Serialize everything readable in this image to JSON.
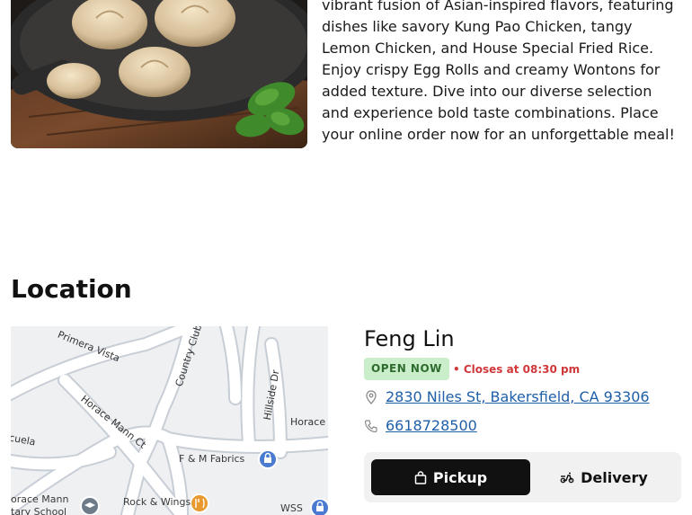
{
  "description": {
    "text": "vibrant fusion of Asian-inspired flavors, featuring dishes like savory Kung Pao Chicken, tangy Lemon Chicken, and House Special Fried Rice. Enjoy crispy Egg Rolls and creamy Wontons for added texture. Dive into our diverse selection and experience bold taste combinations. Place your online order now for an unforgettable meal!"
  },
  "location": {
    "title": "Location"
  },
  "map": {
    "streets": [
      "Primera Vista",
      "Country Club",
      "Hillside Dr",
      "Horace Mann Ct",
      "Horace",
      "cuela"
    ],
    "places": [
      "F & M Fabrics",
      "Rock & Wings",
      "WSS",
      "orace Mann",
      "tary School"
    ]
  },
  "restaurant": {
    "name": "Feng Lin",
    "status": "OPEN NOW",
    "closes": "• Closes at 08:30 pm",
    "address": "2830 Niles St, Bakersfield, CA 93306",
    "phone": "6618728500"
  },
  "order_mode": {
    "pickup_label": "Pickup",
    "delivery_label": "Delivery",
    "selected": "Pickup"
  },
  "colors": {
    "open_badge_bg": "#c9eec9",
    "open_badge_text": "#2f6b2f",
    "closes_text": "#d0383b",
    "link": "#1f5fa8",
    "active_button": "#111111"
  }
}
